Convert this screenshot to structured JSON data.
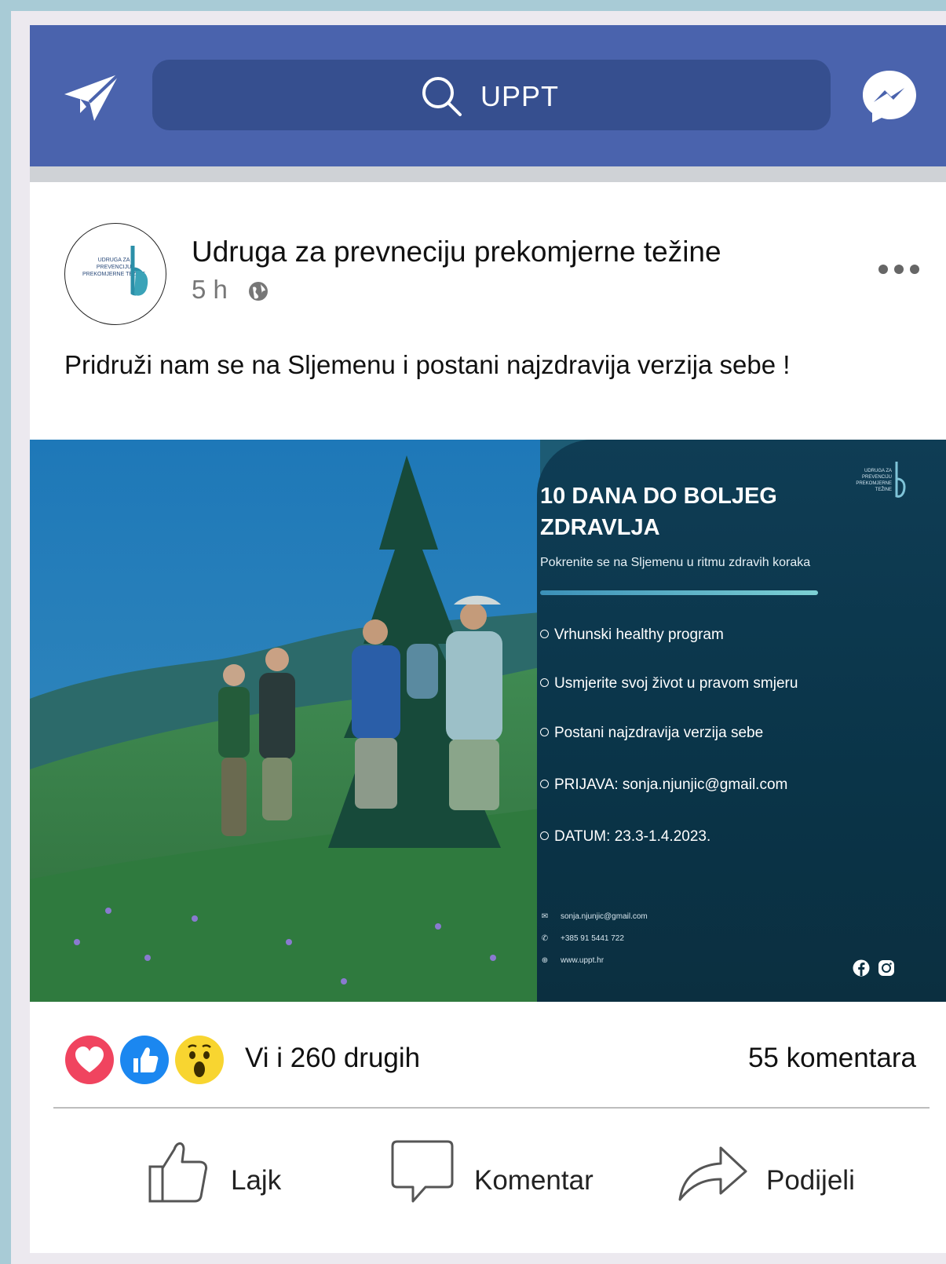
{
  "header": {
    "search_text": "UPPT",
    "icons": [
      "send-icon",
      "search-icon",
      "messenger-icon"
    ],
    "color": "#4a63ad"
  },
  "post": {
    "page_name": "Udruga za prevneciju prekomjerne težine",
    "time": "5 h",
    "text": "Pridruži nam se na Sljemenu i postani najzdravija verzija sebe !",
    "avatar_text": "UDRUGA ZA PREVENCIJU PREKOMJERNE TEŽINE"
  },
  "flyer": {
    "logo_text": "UDRUGA ZA PREVENCIJU PREKOMJERNE TEŽINE",
    "title": "10 DANA DO BOLJEG ZDRAVLJA",
    "subtitle": "Pokrenite se na Sljemenu u ritmu zdravih koraka",
    "bullets": [
      "Vrhunski healthy program",
      "Usmjerite svoj život u pravom smjeru",
      "Postani najzdravija verzija  sebe",
      "PRIJAVA: sonja.njunjic@gmail.com",
      "DATUM: 23.3-1.4.2023."
    ],
    "contacts": {
      "email": "sonja.njunjic@gmail.com",
      "phone": "+385 91 5441 722",
      "web": "www.uppt.hr"
    }
  },
  "engagement": {
    "reactions": [
      "heart-reaction-icon",
      "like-reaction-icon",
      "wow-reaction-icon"
    ],
    "reaction_text": "Vi i 260 drugih",
    "comments_text": "55 komentara"
  },
  "actions": {
    "like": "Lajk",
    "comment": "Komentar",
    "share": "Podijeli"
  }
}
